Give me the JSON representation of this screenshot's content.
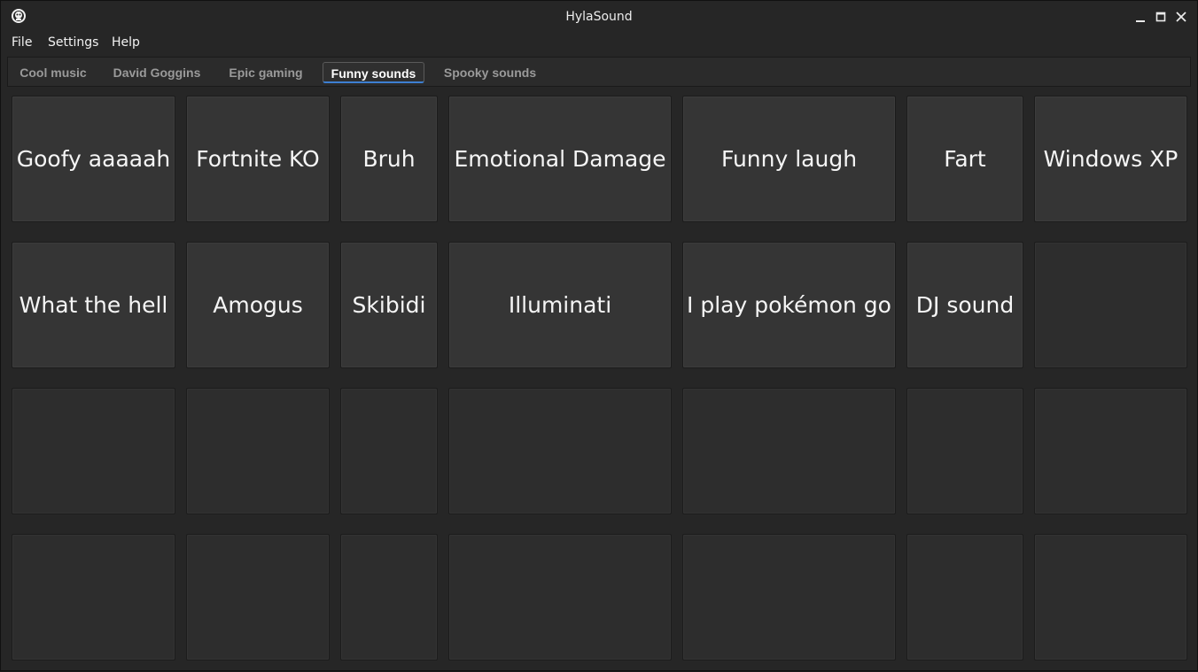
{
  "window": {
    "title": "HylaSound"
  },
  "menu": [
    "File",
    "Settings",
    "Help"
  ],
  "tabs": [
    {
      "label": "Cool music",
      "active": false
    },
    {
      "label": "David Goggins",
      "active": false
    },
    {
      "label": "Epic gaming",
      "active": false
    },
    {
      "label": "Funny sounds",
      "active": true
    },
    {
      "label": "Spooky sounds",
      "active": false
    }
  ],
  "pads": [
    [
      "Goofy aaaaah",
      "Fortnite KO",
      "Bruh",
      "Emotional Damage",
      "Funny laugh",
      "Fart",
      "Windows XP"
    ],
    [
      "What the hell",
      "Amogus",
      "Skibidi",
      "Illuminati",
      "I play pokémon go",
      "DJ sound",
      ""
    ],
    [
      "",
      "",
      "",
      "",
      "",
      "",
      ""
    ],
    [
      "",
      "",
      "",
      "",
      "",
      "",
      ""
    ]
  ],
  "colors": {
    "accent": "#3d7fd1",
    "background": "#262626",
    "pad": "#353535"
  }
}
